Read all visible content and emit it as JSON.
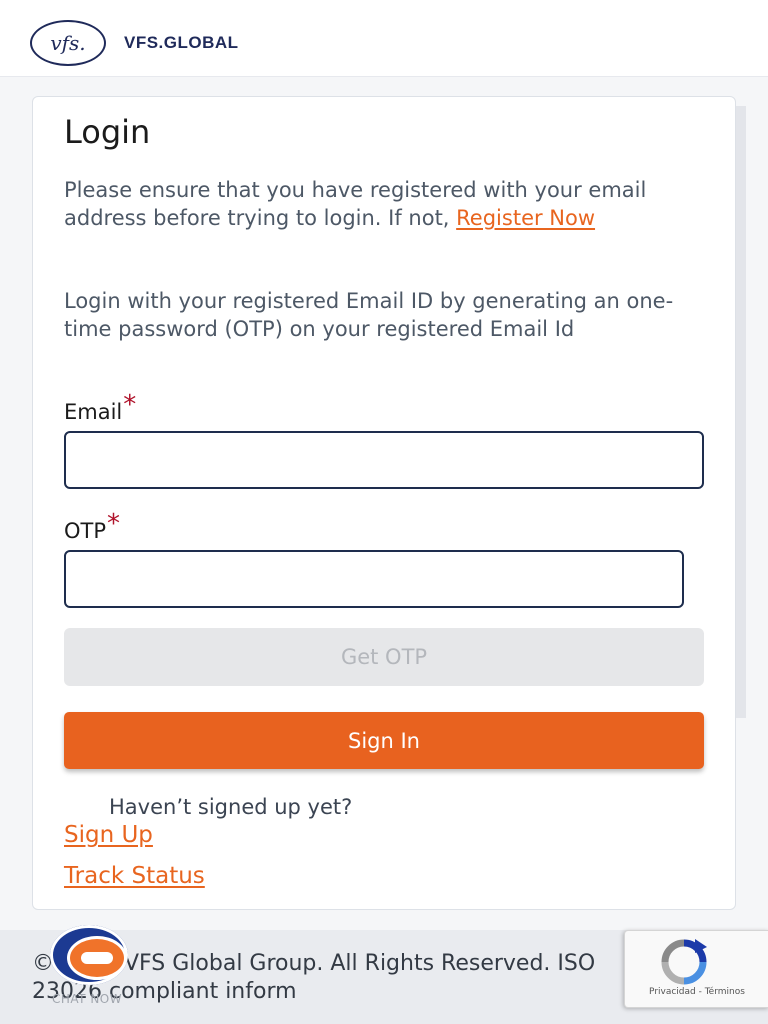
{
  "header": {
    "logo_mark": "vfs.",
    "logo_text": "VFS.GLOBAL"
  },
  "login": {
    "title": "Login",
    "intro": "Please ensure that you have registered with your email address before trying to login. If not, ",
    "register_link": "Register Now",
    "instruction": "Login with your registered Email ID by generating an one-time password (OTP) on your registered Email Id",
    "email_label": "Email",
    "email_value": "",
    "otp_label": "OTP",
    "otp_value": "",
    "required_mark": "*",
    "get_otp_label": "Get OTP",
    "sign_in_label": "Sign In",
    "signup_prompt": "Haven’t signed up yet?",
    "signup_link": "Sign Up",
    "track_link": "Track Status"
  },
  "footer": {
    "copyright": "© 2024 VFS Global Group. All Rights Reserved. ISO 23026 compliant inform",
    "chat_label": "CHAT NOW"
  },
  "recaptcha": {
    "text": "Privacidad - Términos",
    "icon": "recaptcha-icon"
  },
  "colors": {
    "accent": "#e8621f",
    "link": "#e8651f",
    "brand": "#1f2a5a",
    "required": "#b0132b"
  }
}
